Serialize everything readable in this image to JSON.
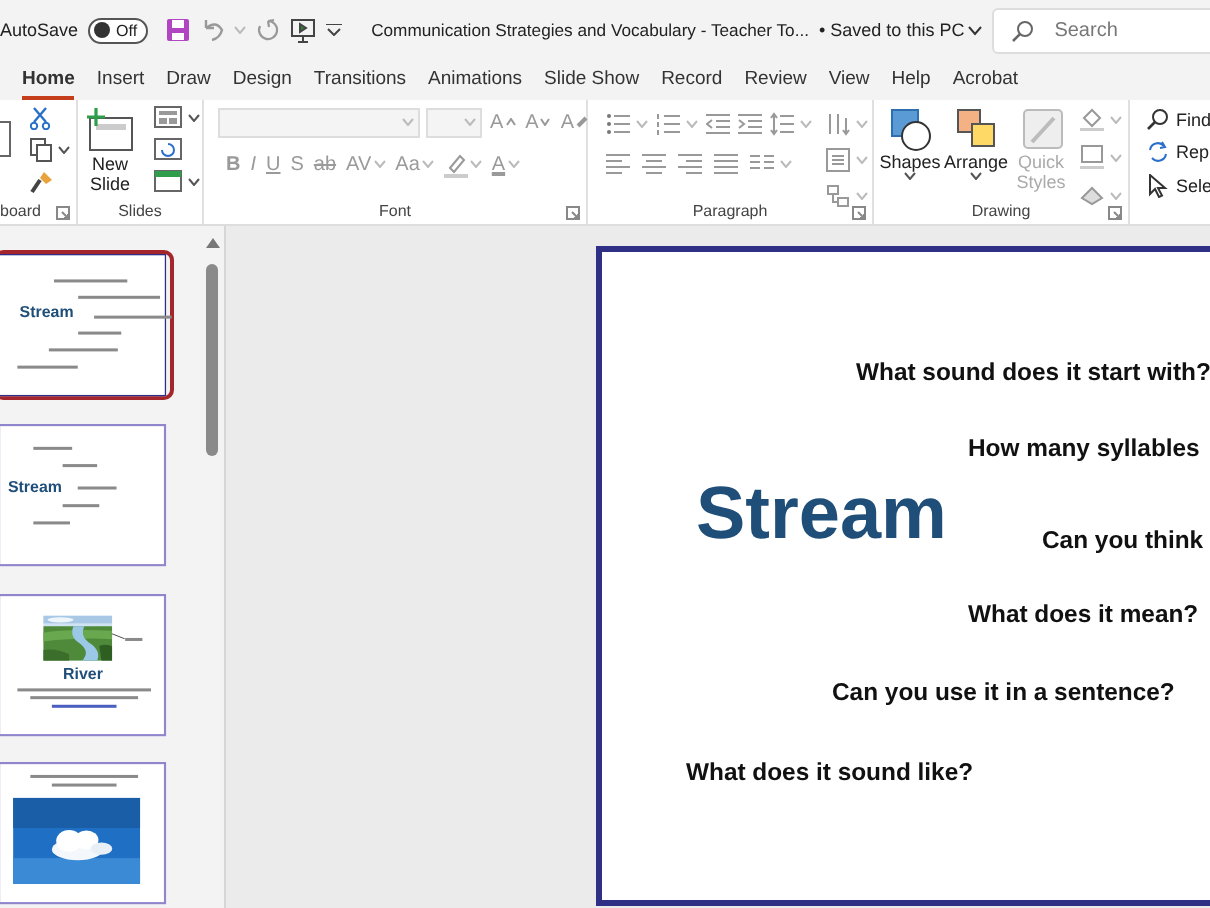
{
  "title_bar": {
    "autosave": {
      "label": "AutoSave",
      "on": false,
      "state_label": "Off"
    },
    "document_title": "Communication Strategies and Vocabulary - Teacher To...",
    "save_status": "• Saved to this PC",
    "search": {
      "placeholder": "Search"
    }
  },
  "tabs": [
    {
      "label": "Home",
      "selected": true
    },
    {
      "label": "Insert",
      "selected": false
    },
    {
      "label": "Draw",
      "selected": false
    },
    {
      "label": "Design",
      "selected": false
    },
    {
      "label": "Transitions",
      "selected": false
    },
    {
      "label": "Animations",
      "selected": false
    },
    {
      "label": "Slide Show",
      "selected": false
    },
    {
      "label": "Record",
      "selected": false
    },
    {
      "label": "Review",
      "selected": false
    },
    {
      "label": "View",
      "selected": false
    },
    {
      "label": "Help",
      "selected": false
    },
    {
      "label": "Acrobat",
      "selected": false
    }
  ],
  "ribbon": {
    "groups": [
      {
        "kind": "clipboard",
        "label": "board"
      },
      {
        "kind": "slides",
        "label": "Slides",
        "new_slide": "New Slide"
      },
      {
        "kind": "font",
        "label": "Font",
        "row1": [
          {
            "kind": "grow",
            "label": "A",
            "disabled": true
          },
          {
            "kind": "shrink",
            "label": "A",
            "disabled": true
          },
          {
            "kind": "clear",
            "label": "A",
            "disabled": true
          }
        ],
        "row2": [
          {
            "kind": "bold",
            "label": "B",
            "disabled": true
          },
          {
            "kind": "italic",
            "label": "I",
            "disabled": true
          },
          {
            "kind": "underline",
            "label": "U",
            "disabled": true
          },
          {
            "kind": "shadow",
            "label": "S",
            "disabled": true
          },
          {
            "kind": "strike",
            "label": "ab",
            "disabled": true
          },
          {
            "kind": "spacing",
            "label": "AV",
            "disabled": true
          },
          {
            "kind": "case",
            "label": "Aa",
            "disabled": true
          },
          {
            "kind": "highlight",
            "disabled": true
          },
          {
            "kind": "color",
            "label": "A",
            "disabled": true
          }
        ]
      },
      {
        "kind": "paragraph",
        "label": "Paragraph"
      },
      {
        "kind": "drawing",
        "label": "Drawing",
        "buttons": [
          {
            "kind": "shapes",
            "label": "Shapes",
            "disabled": false
          },
          {
            "kind": "arrange",
            "label": "Arrange",
            "disabled": false
          },
          {
            "kind": "styles",
            "label": "Quick Styles",
            "disabled": true
          }
        ]
      },
      {
        "kind": "editing",
        "items": [
          {
            "kind": "find",
            "label": "Find"
          },
          {
            "kind": "replace",
            "label": "Rep"
          },
          {
            "kind": "select",
            "label": "Sele"
          }
        ]
      }
    ]
  },
  "thumbnails": [
    {
      "kind": "questions",
      "selected": true,
      "items": [
        {
          "kind": "title",
          "text": "Stream"
        }
      ]
    },
    {
      "kind": "say",
      "selected": false,
      "items": [
        {
          "kind": "title",
          "text": "Stream"
        }
      ]
    },
    {
      "kind": "river",
      "selected": false,
      "items": [
        {
          "kind": "picture"
        },
        {
          "kind": "title",
          "text": "River"
        }
      ]
    },
    {
      "kind": "cloud",
      "selected": false,
      "items": [
        {
          "kind": "picture"
        }
      ]
    }
  ],
  "slide": {
    "kind": "main",
    "items": [
      {
        "kind": "question",
        "text": "What sound does it start with?"
      },
      {
        "kind": "question",
        "text": "How many syllables"
      },
      {
        "kind": "title",
        "text": "Stream"
      },
      {
        "kind": "question",
        "text": "Can you think"
      },
      {
        "kind": "question",
        "text": "What does it mean?"
      },
      {
        "kind": "question",
        "text": "Can you use it in a sentence?"
      },
      {
        "kind": "question",
        "text": "What does it sound like?"
      }
    ]
  }
}
